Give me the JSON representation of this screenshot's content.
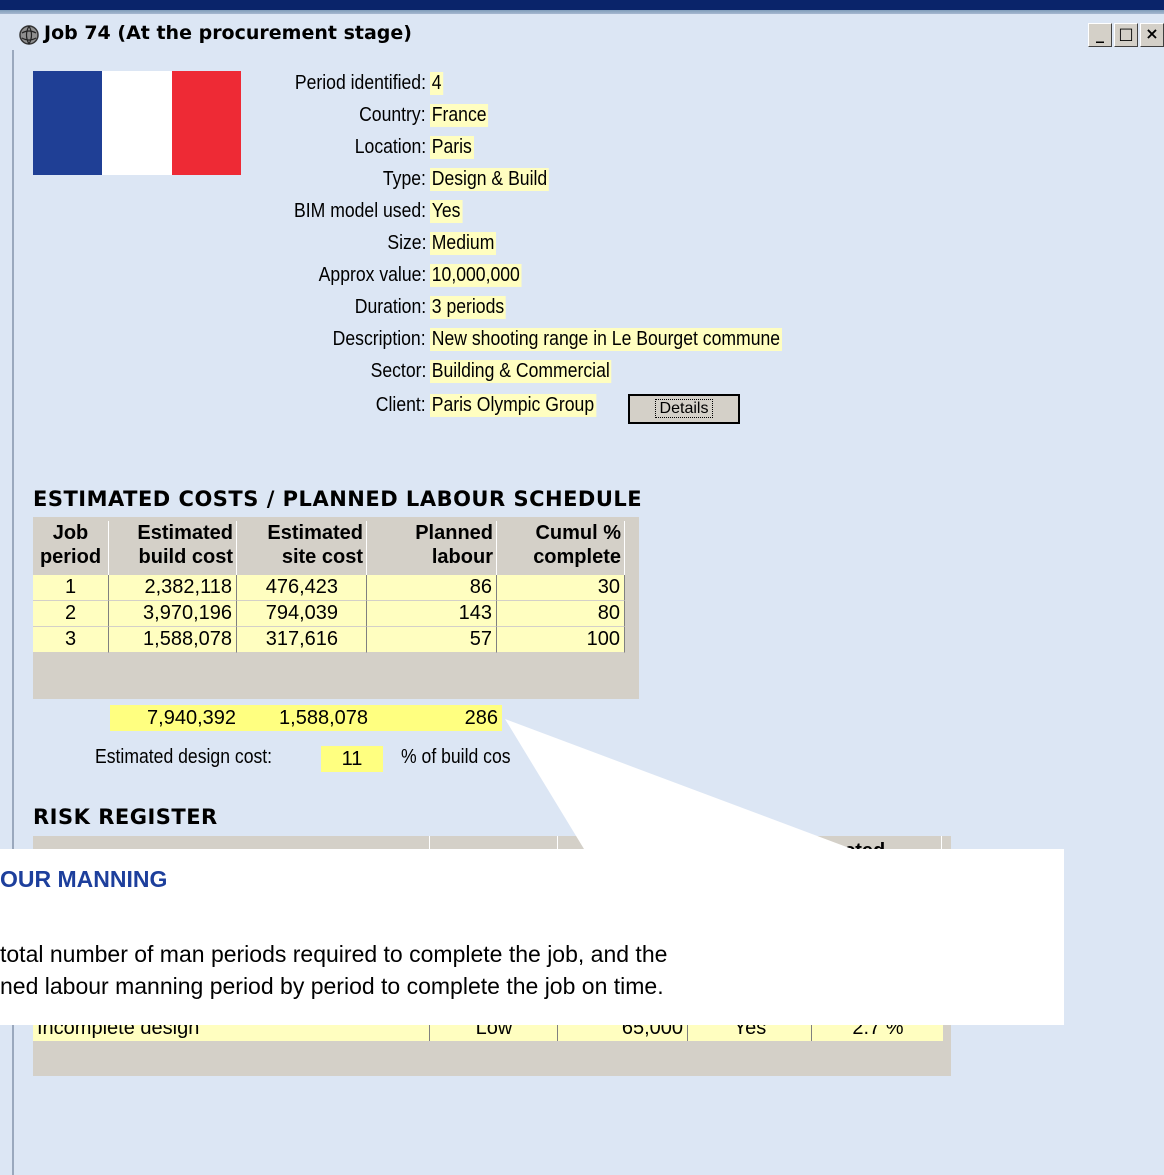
{
  "window": {
    "title": "Job 74  (At the procurement stage)",
    "buttons": {
      "minimize": "_",
      "maximize": "□",
      "close": "×"
    }
  },
  "job": {
    "fields": [
      {
        "label": "Period identified:",
        "value": "4"
      },
      {
        "label": "Country:",
        "value": "France"
      },
      {
        "label": "Location:",
        "value": "Paris"
      },
      {
        "label": "Type:",
        "value": "Design & Build"
      },
      {
        "label": "BIM model used:",
        "value": "Yes"
      },
      {
        "label": "Size:",
        "value": "Medium"
      },
      {
        "label": "Approx value:",
        "value": "10,000,000"
      },
      {
        "label": "Duration:",
        "value": "3 periods"
      },
      {
        "label": "Description:",
        "value": "New shooting range in Le Bourget commune"
      },
      {
        "label": "Sector:",
        "value": "Building & Commercial"
      },
      {
        "label": "Client:",
        "value": "Paris Olympic Group"
      }
    ],
    "details_button": "Details",
    "flag_colors": [
      "#1f3f95",
      "#ffffff",
      "#ee2a35"
    ]
  },
  "schedule": {
    "title": "ESTIMATED COSTS / PLANNED LABOUR SCHEDULE",
    "headers": [
      [
        "Job",
        "period"
      ],
      [
        "Estimated",
        "build cost"
      ],
      [
        "Estimated",
        "site cost"
      ],
      [
        "Planned",
        "labour"
      ],
      [
        "Cumul %",
        "complete"
      ]
    ],
    "rows": [
      [
        "1",
        "2,382,118",
        "476,423",
        "86",
        "30"
      ],
      [
        "2",
        "3,970,196",
        "794,039",
        "143",
        "80"
      ],
      [
        "3",
        "1,588,078",
        "317,616",
        "57",
        "100"
      ]
    ],
    "totals": {
      "build": "7,940,392",
      "site": "1,588,078",
      "labour": "286"
    },
    "design_cost_label": "Estimated design cost:",
    "design_cost_value": "11",
    "design_cost_suffix": "% of build cos"
  },
  "risk": {
    "title": "RISK REGISTER",
    "header_partial": "ected",
    "row": [
      "Incomplete design",
      "Low",
      "65,000",
      "Yes",
      "2.7 %"
    ]
  },
  "callout": {
    "title": "OUR MANNING",
    "line1": "total number of man periods required to complete the job, and  the",
    "line2": "ned labour manning period by period to complete the job on time."
  },
  "colors": {
    "window_bg": "#dce6f4",
    "field_bg": "#fffec0",
    "total_bg": "#ffff80",
    "callout_title": "#1d3f9c"
  }
}
